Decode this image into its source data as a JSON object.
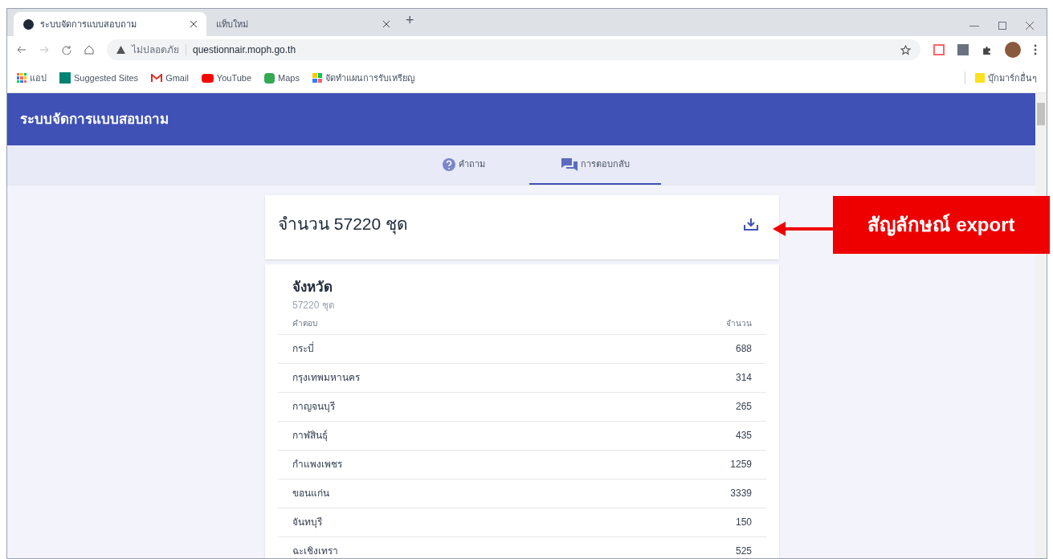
{
  "browser": {
    "tabs": [
      {
        "title": "ระบบจัดการแบบสอบถาม",
        "selected": true
      },
      {
        "title": "แท็บใหม่",
        "selected": false
      }
    ],
    "new_tab": "+",
    "address": {
      "security": "ไม่ปลอดภัย",
      "url": "questionnair.moph.go.th"
    },
    "bookmarks": [
      {
        "label": "แอป",
        "kind": "apps"
      },
      {
        "label": "Suggested Sites",
        "kind": "bing"
      },
      {
        "label": "Gmail",
        "kind": "gmail"
      },
      {
        "label": "YouTube",
        "kind": "youtube"
      },
      {
        "label": "Maps",
        "kind": "maps"
      },
      {
        "label": "จัดทำแผนการรับเหรียญ",
        "kind": "colorful"
      }
    ],
    "other_bookmarks": "บุ๊กมาร์กอื่นๆ"
  },
  "app": {
    "title": "ระบบจัดการแบบสอบถาม",
    "nav_tabs": [
      {
        "label": "คำถาม",
        "kind": "question",
        "selected": false
      },
      {
        "label": "การตอบกลับ",
        "kind": "responses",
        "selected": true
      }
    ],
    "summary": {
      "title": "จำนวน 57220 ชุด"
    },
    "section": {
      "title": "จังหวัด",
      "subtitle": "57220 ชุด",
      "columns": [
        "คำตอบ",
        "จำนวน"
      ],
      "rows": [
        [
          "กระบี่",
          "688"
        ],
        [
          "กรุงเทพมหานคร",
          "314"
        ],
        [
          "กาญจนบุรี",
          "265"
        ],
        [
          "กาฬสินธุ์",
          "435"
        ],
        [
          "กำแพงเพชร",
          "1259"
        ],
        [
          "ขอนแก่น",
          "3339"
        ],
        [
          "จันทบุรี",
          "150"
        ],
        [
          "ฉะเชิงเทรา",
          "525"
        ]
      ]
    }
  },
  "annotation": {
    "label": "สัญลักษณ์ export"
  }
}
